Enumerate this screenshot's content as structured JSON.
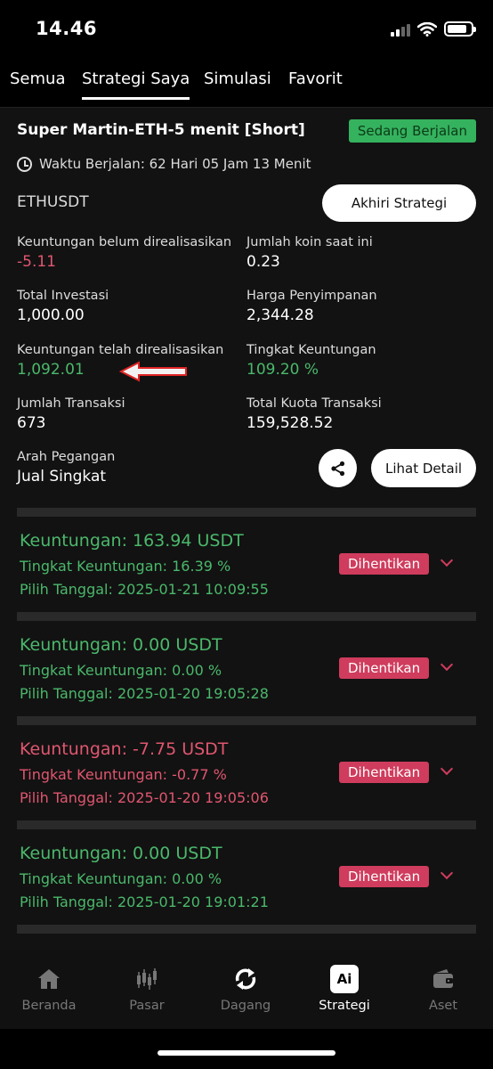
{
  "status": {
    "time": "14.46"
  },
  "tabs": [
    {
      "label": "Semua",
      "active": false
    },
    {
      "label": "Strategi Saya",
      "active": true
    },
    {
      "label": "Simulasi",
      "active": false
    },
    {
      "label": "Favorit",
      "active": false
    }
  ],
  "strategy": {
    "title": "Super Martin-ETH-5 menit [Short]",
    "badge": "Sedang Berjalan",
    "runtime": "Waktu Berjalan: 62 Hari 05 Jam 13 Menit",
    "pair": "ETHUSDT",
    "end_label": "Akhiri Strategi",
    "detail_label": "Lihat Detail",
    "stats": [
      {
        "label": "Keuntungan belum direalisasikan",
        "value": "-5.11"
      },
      {
        "label": "Jumlah koin saat ini",
        "value": "0.23"
      },
      {
        "label": "Total Investasi",
        "value": "1,000.00"
      },
      {
        "label": "Harga Penyimpanan",
        "value": "2,344.28"
      },
      {
        "label": "Keuntungan telah direalisasikan",
        "value": "1,092.01"
      },
      {
        "label": "Tingkat Keuntungan",
        "value": "109.20 %"
      },
      {
        "label": "Jumlah Transaksi",
        "value": "673"
      },
      {
        "label": "Total Kuota Transaksi",
        "value": "159,528.52"
      },
      {
        "label": "Arah Pegangan",
        "value": "Jual Singkat"
      }
    ]
  },
  "history": [
    {
      "profit": "Keuntungan: 163.94 USDT",
      "rate": "Tingkat Keuntungan: 16.39 %",
      "date": "Pilih Tanggal: 2025-01-21 10:09:55",
      "status": "Dihentikan",
      "color": "#4bb86b"
    },
    {
      "profit": "Keuntungan: 0.00 USDT",
      "rate": "Tingkat Keuntungan: 0.00 %",
      "date": "Pilih Tanggal: 2025-01-20 19:05:28",
      "status": "Dihentikan",
      "color": "#4bb86b"
    },
    {
      "profit": "Keuntungan: -7.75 USDT",
      "rate": "Tingkat Keuntungan: -0.77 %",
      "date": "Pilih Tanggal: 2025-01-20 19:05:06",
      "status": "Dihentikan",
      "color": "#e0566f"
    },
    {
      "profit": "Keuntungan: 0.00 USDT",
      "rate": "Tingkat Keuntungan: 0.00 %",
      "date": "Pilih Tanggal: 2025-01-20 19:01:21",
      "status": "Dihentikan",
      "color": "#4bb86b"
    }
  ],
  "nav": [
    {
      "label": "Beranda",
      "icon": "home-icon",
      "active": false
    },
    {
      "label": "Pasar",
      "icon": "candlestick-icon",
      "active": false
    },
    {
      "label": "Dagang",
      "icon": "swap-icon",
      "active": false
    },
    {
      "label": "Strategi",
      "icon": "ai-icon",
      "active": true,
      "icon_text": "Ai"
    },
    {
      "label": "Aset",
      "icon": "wallet-icon",
      "active": false
    }
  ],
  "colors": {
    "accent_green": "#35b25e",
    "profit_green": "#4bb86b",
    "loss_red": "#e0566f",
    "stopped_badge": "#cf3c5d"
  }
}
